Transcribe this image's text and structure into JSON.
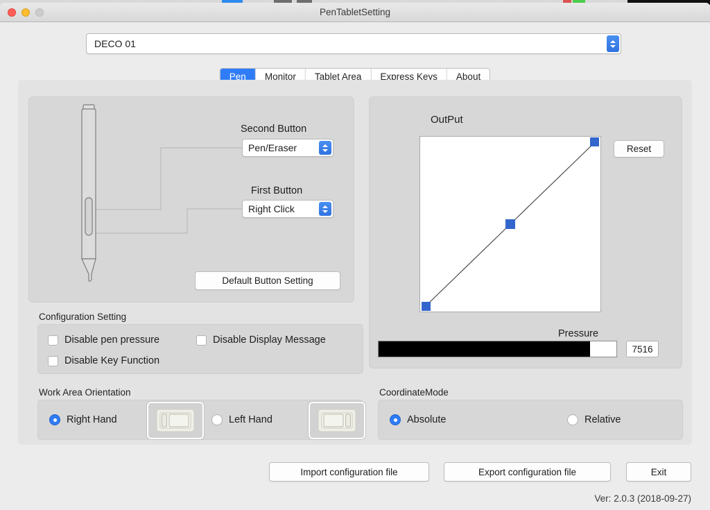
{
  "window": {
    "title": "PenTabletSetting",
    "traffic_lights": [
      "close",
      "minimize",
      "maximize"
    ]
  },
  "device_selector": {
    "value": "DECO 01"
  },
  "tabs": [
    {
      "label": "Pen",
      "active": true
    },
    {
      "label": "Monitor",
      "active": false
    },
    {
      "label": "Tablet Area",
      "active": false
    },
    {
      "label": "Express Keys",
      "active": false
    },
    {
      "label": "About",
      "active": false
    }
  ],
  "pen_panel": {
    "second_button_label": "Second Button",
    "second_button_value": "Pen/Eraser",
    "first_button_label": "First Button",
    "first_button_value": "Right Click",
    "default_button_setting": "Default  Button Setting"
  },
  "output_panel": {
    "title": "OutPut",
    "reset_label": "Reset",
    "pressure_label": "Pressure",
    "pressure_value": "7516",
    "pressure_fill_percent": 89
  },
  "curve": {
    "points": [
      {
        "x": 0.0,
        "y": 0.0
      },
      {
        "x": 0.5,
        "y": 0.5
      },
      {
        "x": 1.0,
        "y": 1.0
      }
    ],
    "handle_color": "#3366cc",
    "line_color": "#4a4a4a"
  },
  "configuration_setting": {
    "title": "Configuration Setting",
    "items": [
      {
        "label": "Disable pen pressure",
        "checked": false
      },
      {
        "label": "Disable Display Message",
        "checked": false
      },
      {
        "label": "Disable Key Function",
        "checked": false
      }
    ]
  },
  "work_area_orientation": {
    "title": "Work Area Orientation",
    "options": [
      {
        "label": "Right Hand",
        "selected": true,
        "keys_side": "left"
      },
      {
        "label": "Left Hand",
        "selected": false,
        "keys_side": "right"
      }
    ]
  },
  "coordinate_mode": {
    "title": "CoordinateMode",
    "options": [
      {
        "label": "Absolute",
        "selected": true
      },
      {
        "label": "Relative",
        "selected": false
      }
    ]
  },
  "footer": {
    "import_label": "Import configuration file",
    "export_label": "Export configuration file",
    "exit_label": "Exit",
    "version": "Ver: 2.0.3 (2018-09-27)"
  },
  "colors": {
    "accent": "#2f7cf6",
    "window_bg": "#ececec",
    "panel_bg": "#d7d7d7",
    "content_bg": "#e3e3e3"
  }
}
